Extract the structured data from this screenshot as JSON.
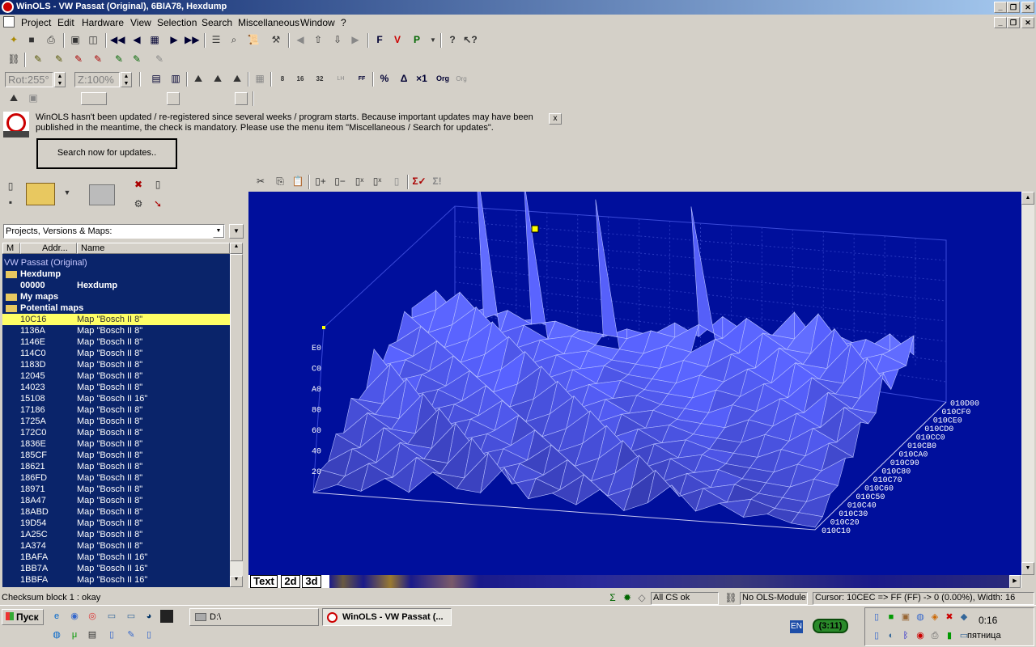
{
  "window": {
    "title": "WinOLS - VW Passat (Original), 6BIA78, Hexdump"
  },
  "menu": [
    "Project",
    "Edit",
    "Hardware",
    "View",
    "Selection",
    "Search",
    "Miscellaneous",
    "Window",
    "?"
  ],
  "toolbar3": {
    "rot": "Rot:255°",
    "zoom": "Z:100%"
  },
  "notice": {
    "text": "WinOLS hasn't been updated / re-registered since several weeks / program starts. Because important updates may have been published in the meantime, the check is mandatory. Please use the menu item \"Miscellaneous / Search for updates\".",
    "button": "Search now for updates..",
    "close": "x"
  },
  "left": {
    "dropdown": "Projects, Versions & Maps:",
    "col_m": "M",
    "col_addr": "Addr...",
    "col_name": "Name"
  },
  "tree": {
    "project": "VW Passat (Original)",
    "hexdump_folder": "Hexdump",
    "hexdump_addr": "00000",
    "hexdump_name": "Hexdump",
    "mymaps": "My maps",
    "potential": "Potential maps",
    "maps": [
      {
        "addr": "10C16",
        "name": "Map \"Bosch II 8\""
      },
      {
        "addr": "1136A",
        "name": "Map \"Bosch II 8\""
      },
      {
        "addr": "1146E",
        "name": "Map \"Bosch II 8\""
      },
      {
        "addr": "114C0",
        "name": "Map \"Bosch II 8\""
      },
      {
        "addr": "1183D",
        "name": "Map \"Bosch II 8\""
      },
      {
        "addr": "12045",
        "name": "Map \"Bosch II 8\""
      },
      {
        "addr": "14023",
        "name": "Map \"Bosch II 8\""
      },
      {
        "addr": "15108",
        "name": "Map \"Bosch II 16\""
      },
      {
        "addr": "17186",
        "name": "Map \"Bosch II 8\""
      },
      {
        "addr": "1725A",
        "name": "Map \"Bosch II 8\""
      },
      {
        "addr": "172C0",
        "name": "Map \"Bosch II 8\""
      },
      {
        "addr": "1836E",
        "name": "Map \"Bosch II 8\""
      },
      {
        "addr": "185CF",
        "name": "Map \"Bosch II 8\""
      },
      {
        "addr": "18621",
        "name": "Map \"Bosch II 8\""
      },
      {
        "addr": "186FD",
        "name": "Map \"Bosch II 8\""
      },
      {
        "addr": "18971",
        "name": "Map \"Bosch II 8\""
      },
      {
        "addr": "18A47",
        "name": "Map \"Bosch II 8\""
      },
      {
        "addr": "18ABD",
        "name": "Map \"Bosch II 8\""
      },
      {
        "addr": "19D54",
        "name": "Map \"Bosch II 8\""
      },
      {
        "addr": "1A25C",
        "name": "Map \"Bosch II 8\""
      },
      {
        "addr": "1A374",
        "name": "Map \"Bosch II 8\""
      },
      {
        "addr": "1BAFA",
        "name": "Map \"Bosch II 16\""
      },
      {
        "addr": "1BB7A",
        "name": "Map \"Bosch II 16\""
      },
      {
        "addr": "1BBFA",
        "name": "Map \"Bosch II 16\""
      }
    ]
  },
  "plot": {
    "yticks": [
      "E0",
      "C0",
      "A0",
      "80",
      "60",
      "40",
      "20"
    ],
    "xticks": [
      "010C10",
      "010C20",
      "010C30",
      "010C40",
      "010C50",
      "010C60",
      "010C70",
      "010C80",
      "010C90",
      "010CA0",
      "010CB0",
      "010CC0",
      "010CD0",
      "010CE0",
      "010CF0",
      "010D00"
    ]
  },
  "tabs": [
    "Text",
    "2d",
    "3d"
  ],
  "status": {
    "left": "Checksum block 1 : okay",
    "cs": "All CS ok",
    "module": "No OLS-Module",
    "cursor": "Cursor: 10CEC => FF (FF) -> 0 (0.00%), Width: 16"
  },
  "taskbar": {
    "start": "Пуск",
    "task1": "D:\\",
    "task2": "WinOLS - VW Passat (...",
    "lang": "EN",
    "timer": "(3:11)",
    "time": "0:16",
    "day": "пятница"
  }
}
